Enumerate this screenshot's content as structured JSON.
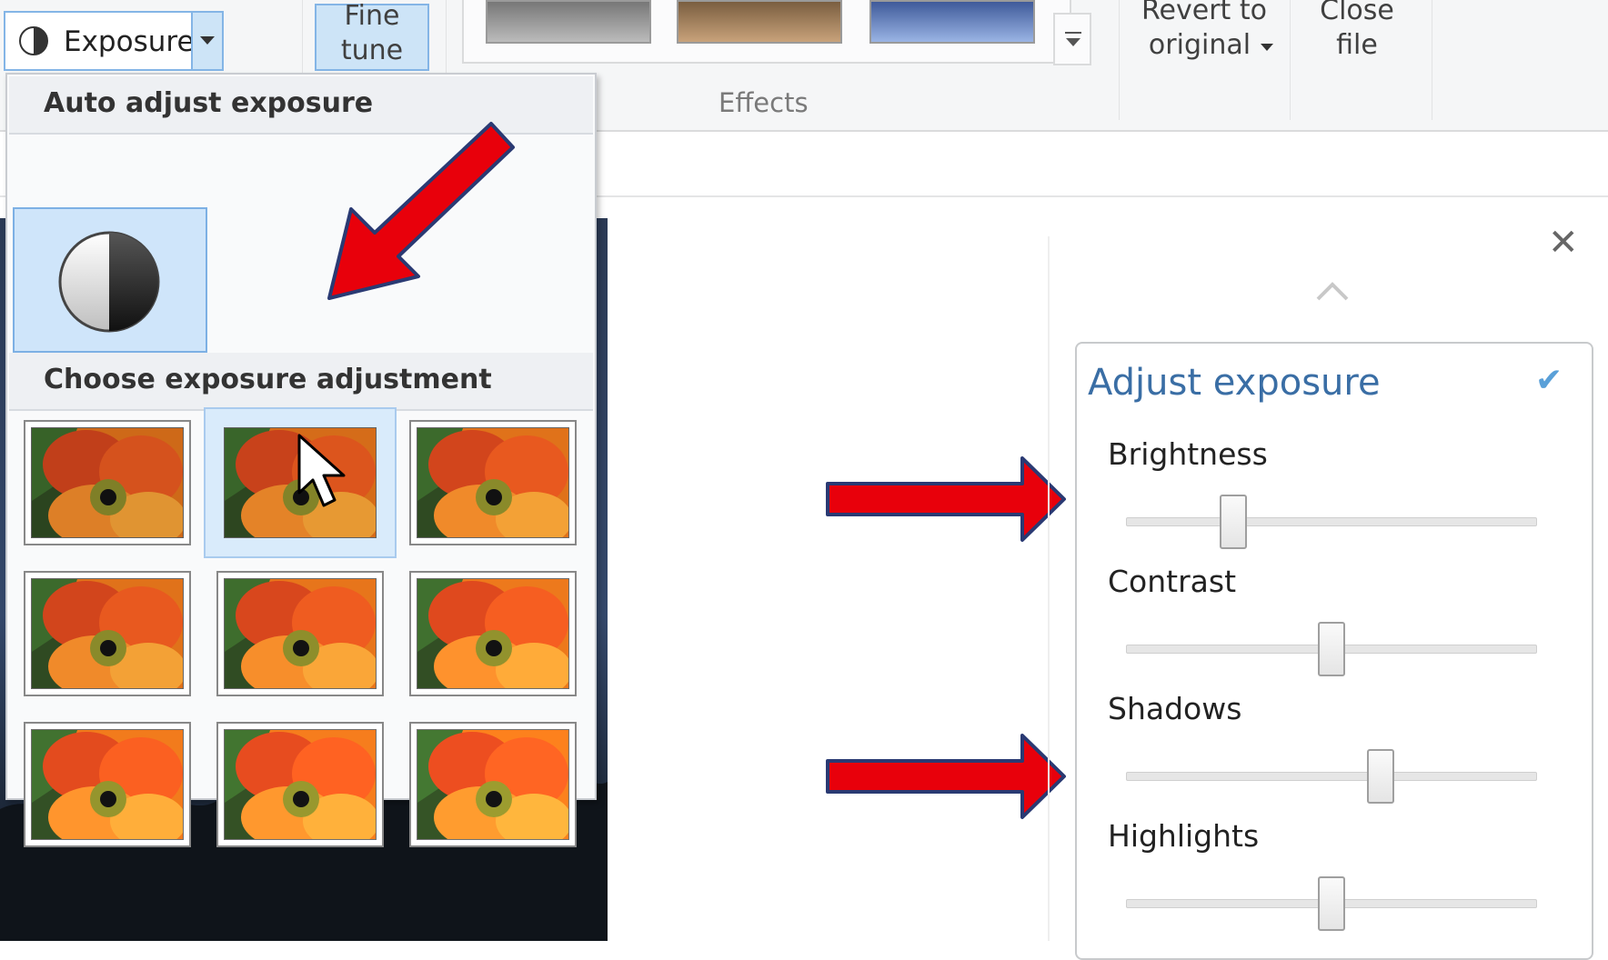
{
  "ribbon": {
    "exposure_label": "Exposure",
    "fine_tune_line1": "Fine",
    "fine_tune_line2": "tune",
    "effects_label": "Effects",
    "revert_line1": "Revert to",
    "revert_line2": "original",
    "close_line1": "Close",
    "close_line2": "file"
  },
  "exposure_menu": {
    "auto_heading": "Auto adjust exposure",
    "choose_heading": "Choose exposure adjustment",
    "presets": [
      {
        "id": 1,
        "hovered": false
      },
      {
        "id": 2,
        "hovered": true
      },
      {
        "id": 3,
        "hovered": false
      },
      {
        "id": 4,
        "hovered": false
      },
      {
        "id": 5,
        "hovered": false
      },
      {
        "id": 6,
        "hovered": false
      },
      {
        "id": 7,
        "hovered": false
      },
      {
        "id": 8,
        "hovered": false
      },
      {
        "id": 9,
        "hovered": false
      }
    ]
  },
  "adjust_panel": {
    "title": "Adjust exposure",
    "sliders": [
      {
        "label": "Brightness",
        "value": 0.26
      },
      {
        "label": "Contrast",
        "value": 0.5
      },
      {
        "label": "Shadows",
        "value": 0.62
      },
      {
        "label": "Highlights",
        "value": 0.5
      }
    ]
  },
  "icons": {
    "exposure": "half-circle-icon",
    "close": "close-icon",
    "collapse": "chevron-up-icon",
    "confirm": "checkmark-icon"
  },
  "colors": {
    "accent_blue": "#3a6ea5",
    "selection_fill": "#cde4f7",
    "annotation_red": "#e8000b"
  }
}
